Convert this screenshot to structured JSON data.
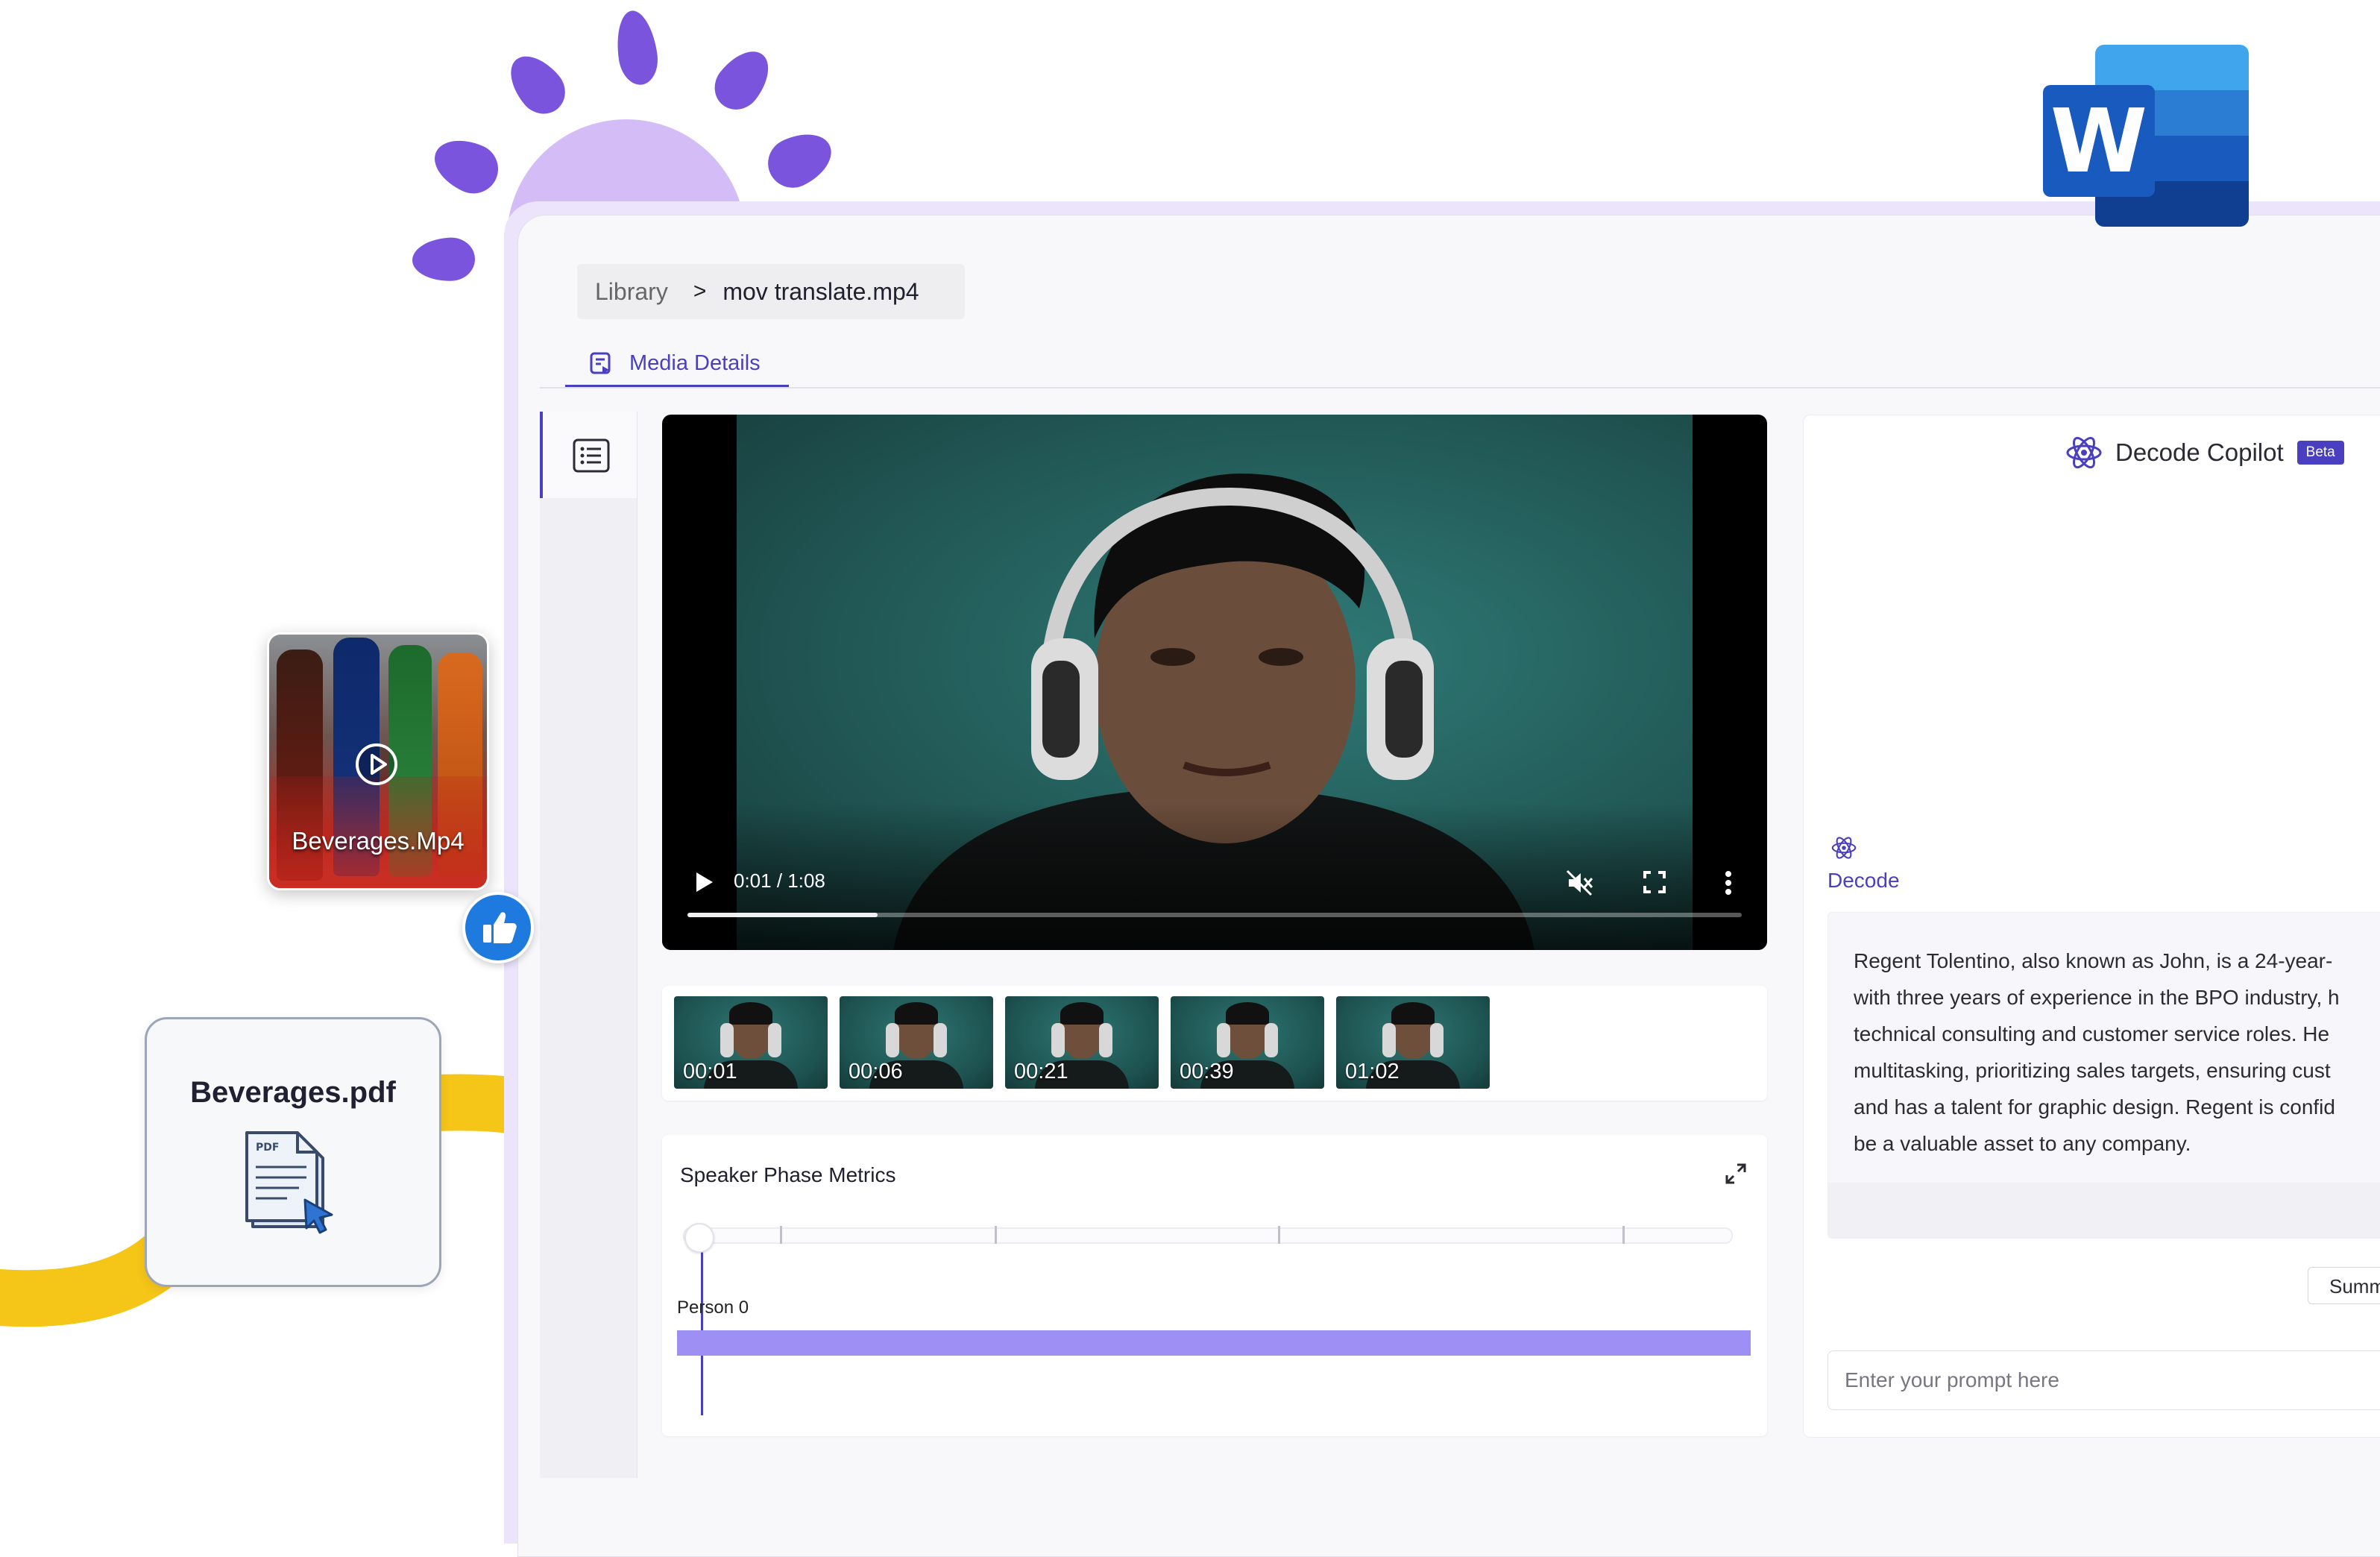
{
  "breadcrumb": {
    "library": "Library",
    "separator": ">",
    "current_file": "mov translate.mp4"
  },
  "tabs": [
    {
      "label": "Media Details",
      "active": true
    }
  ],
  "video": {
    "time": "0:01 / 1:08",
    "muted": true,
    "progress": 0.18
  },
  "thumbnails": [
    {
      "time": "00:01"
    },
    {
      "time": "00:06"
    },
    {
      "time": "00:21"
    },
    {
      "time": "00:39"
    },
    {
      "time": "01:02"
    }
  ],
  "speaker_metrics": {
    "title": "Speaker Phase Metrics",
    "person_label": "Person 0"
  },
  "copilot": {
    "title": "Decode Copilot",
    "badge": "Beta",
    "decode_label": "Decode",
    "answer_lines": [
      "Regent Tolentino, also known as John, is a 24-year-",
      "with three years of experience in the BPO industry, h",
      "technical consulting and customer service roles. He",
      "multitasking, prioritizing sales targets, ensuring cust",
      "and has a talent for graphic design. Regent is confid",
      "be a valuable asset to any company."
    ],
    "summarize_button": "Summ",
    "prompt_placeholder": "Enter your prompt here"
  },
  "floating": {
    "video_card_label": "Beverages.Mp4",
    "pdf_card_title": "Beverages.pdf",
    "pdf_icon_text": "PDF"
  },
  "colors": {
    "accent": "#4a3fc0",
    "person_bar": "#9d8ff4",
    "decor_purple": "#7b54dd",
    "decor_yellow": "#f5c518",
    "like_blue": "#1f7ae0"
  },
  "icons": [
    "list-icon",
    "media-details-icon",
    "play-icon",
    "mute-icon",
    "fullscreen-icon",
    "more-vert-icon",
    "expand-icon",
    "atom-icon",
    "thumbs-up-icon",
    "pdf-file-icon",
    "word-logo-icon"
  ]
}
